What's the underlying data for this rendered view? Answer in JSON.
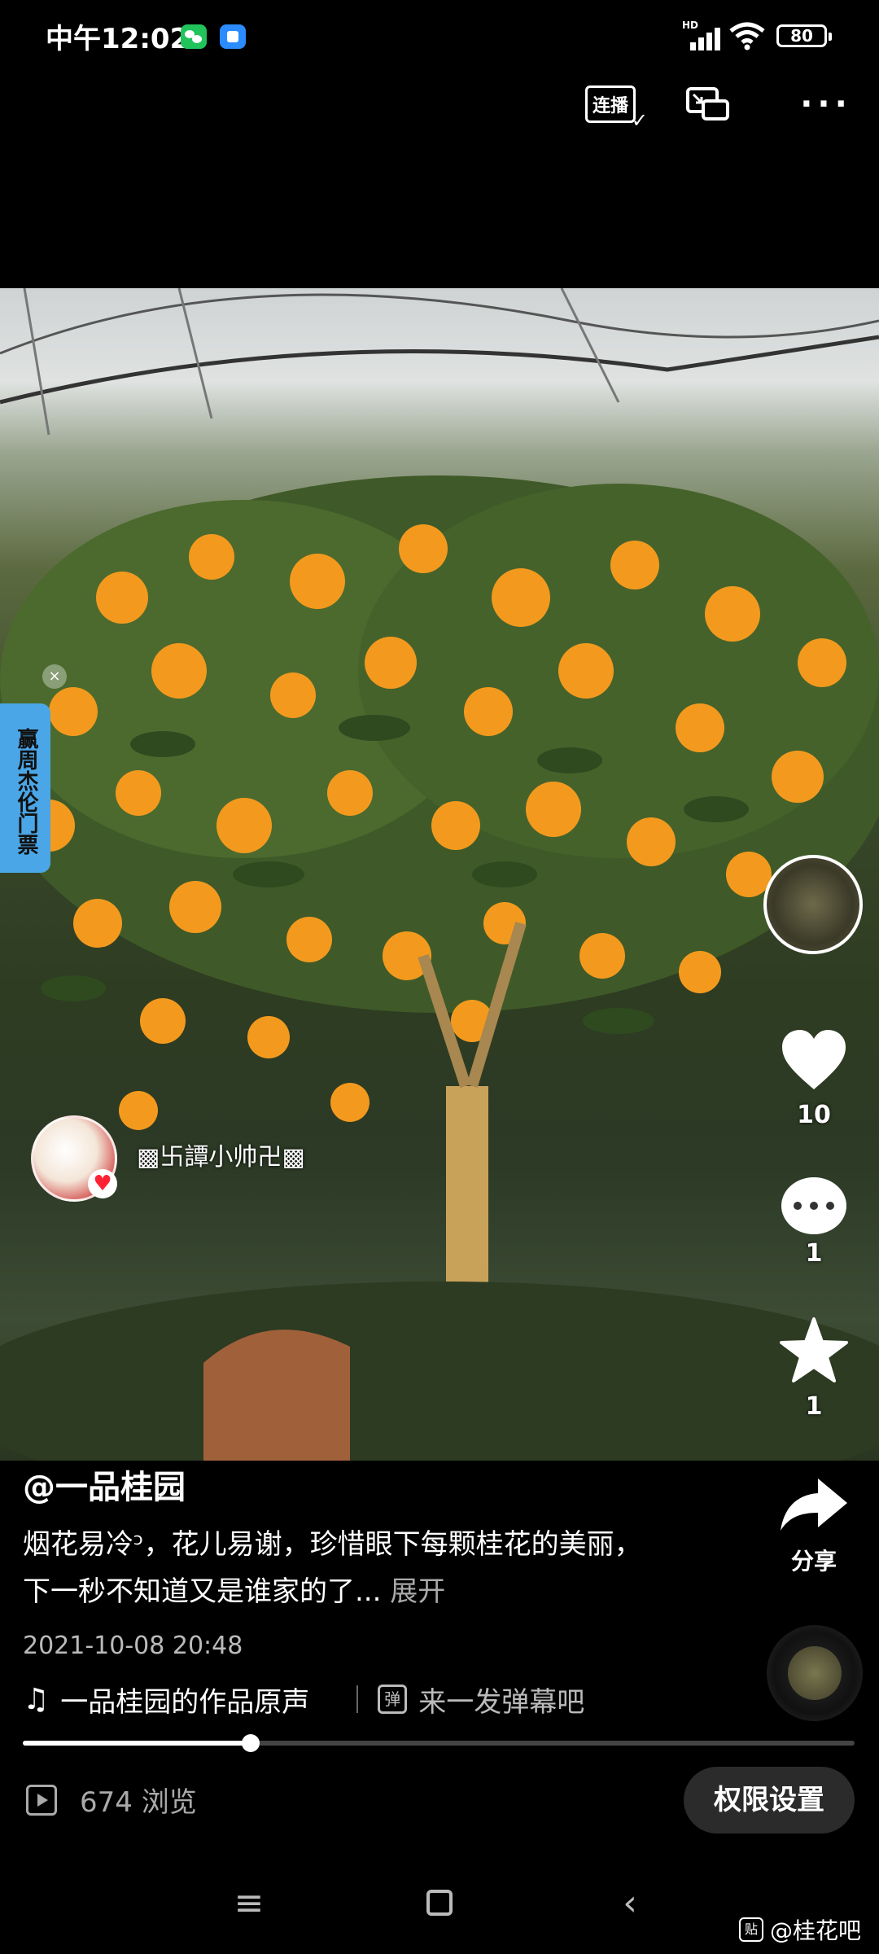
{
  "status_bar": {
    "time": "中午12:02",
    "network": "HD",
    "battery": "80"
  },
  "top_actions": {
    "autoplay_label": "连播"
  },
  "promo": {
    "label": "赢周杰伦门票"
  },
  "author": {
    "name": "▩卐譚小帅卍▩"
  },
  "side_actions": {
    "likes": "10",
    "comments": "1",
    "favorites": "1",
    "share_label": "分享"
  },
  "post": {
    "handle": "@一品桂园",
    "caption": "烟花易冷ᵓ，花儿易谢，珍惜眼下每颗桂花的美丽，下一秒不知道又是谁家的了...",
    "expand_label": "展开",
    "date": "2021-10-08 20:48",
    "music": "一品桂园的作品原声",
    "danmu_icon_text": "弹",
    "danmu_placeholder": "来一发弹幕吧"
  },
  "playback": {
    "progress": 0.274
  },
  "footer": {
    "views": "674 浏览",
    "permission_button": "权限设置"
  },
  "watermark": {
    "logo": "贴",
    "text": "@桂花吧"
  },
  "colors": {
    "background": "#000000",
    "flower": "#f39a1e",
    "promo_tag": "#4aa6e6"
  }
}
